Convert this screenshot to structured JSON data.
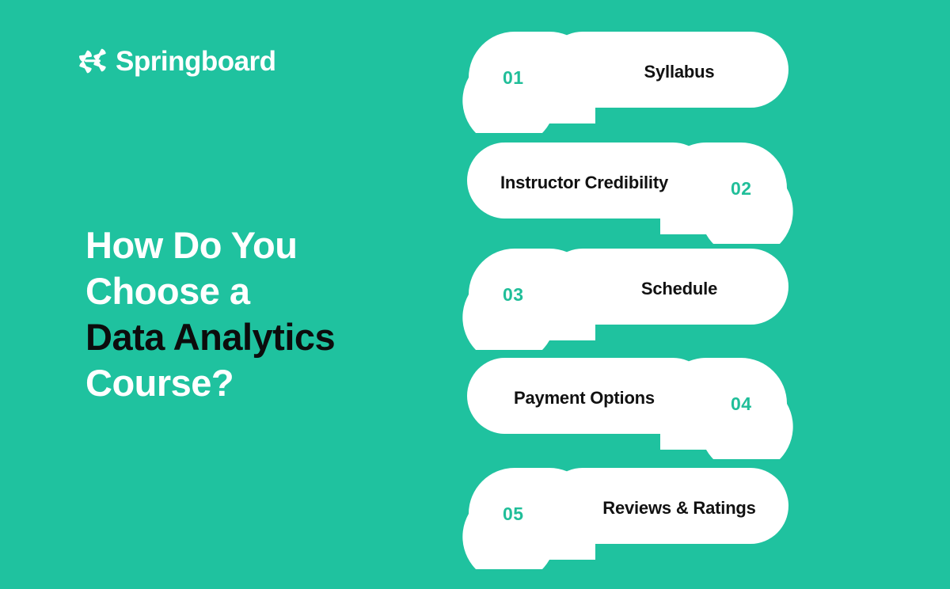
{
  "background_color": "#1FC29F",
  "brand": {
    "logo_icon": "springboard-starburst-icon",
    "name": "Springboard",
    "logo_color": "#FFFFFF"
  },
  "headline": {
    "line1": "How Do You",
    "line2": "Choose a",
    "line3": "Data Analytics",
    "line4": "Course?",
    "white_color": "#FFFFFF",
    "highlight_color": "#0C0C0C"
  },
  "cards": [
    {
      "number": "01",
      "label": "Syllabus",
      "number_side": "left",
      "number_color": "#20BE99",
      "label_color": "#111111",
      "card_color": "#FFFFFF"
    },
    {
      "number": "02",
      "label": "Instructor Credibility",
      "number_side": "right",
      "number_color": "#20BE99",
      "label_color": "#111111",
      "card_color": "#FFFFFF"
    },
    {
      "number": "03",
      "label": "Schedule",
      "number_side": "left",
      "number_color": "#20BE99",
      "label_color": "#111111",
      "card_color": "#FFFFFF"
    },
    {
      "number": "04",
      "label": "Payment Options",
      "number_side": "right",
      "number_color": "#20BE99",
      "label_color": "#111111",
      "card_color": "#FFFFFF"
    },
    {
      "number": "05",
      "label": "Reviews & Ratings",
      "number_side": "left",
      "number_color": "#20BE99",
      "label_color": "#111111",
      "card_color": "#FFFFFF"
    }
  ]
}
